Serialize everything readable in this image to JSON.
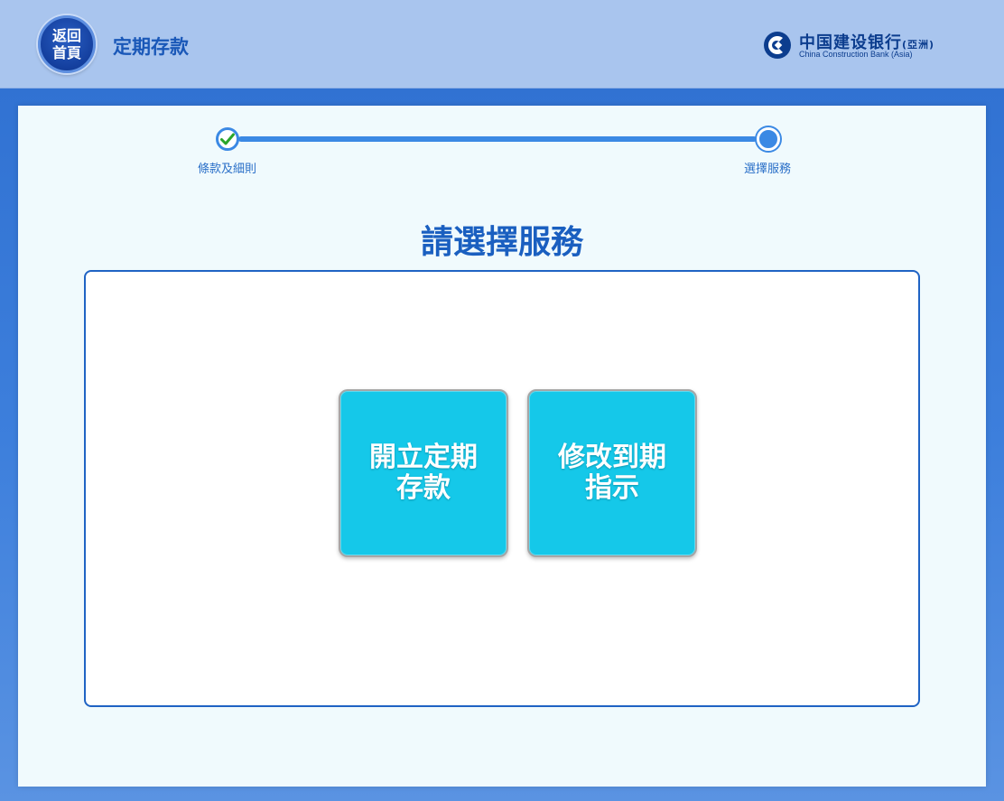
{
  "header": {
    "home_button": {
      "line1": "返回",
      "line2": "首頁"
    },
    "title": "定期存款",
    "logo": {
      "cn": "中国建设银行",
      "cn_suffix": "(亞洲)",
      "en": "China Construction Bank (Asia)"
    }
  },
  "stepper": {
    "steps": [
      {
        "label": "條款及細則",
        "status": "done"
      },
      {
        "label": "選擇服務",
        "status": "current"
      }
    ]
  },
  "main": {
    "prompt": "請選擇服務",
    "options": [
      {
        "label": "開立定期存款"
      },
      {
        "label": "修改到期指示"
      }
    ]
  },
  "colors": {
    "header_bg": "#a9c5ee",
    "accent_blue": "#1a5fc0",
    "tile_cyan": "#15c8e9",
    "check_green": "#2aa52a"
  },
  "icons": {
    "home": "home-button-icon",
    "check": "check-icon",
    "logo": "ccb-logo-icon"
  }
}
